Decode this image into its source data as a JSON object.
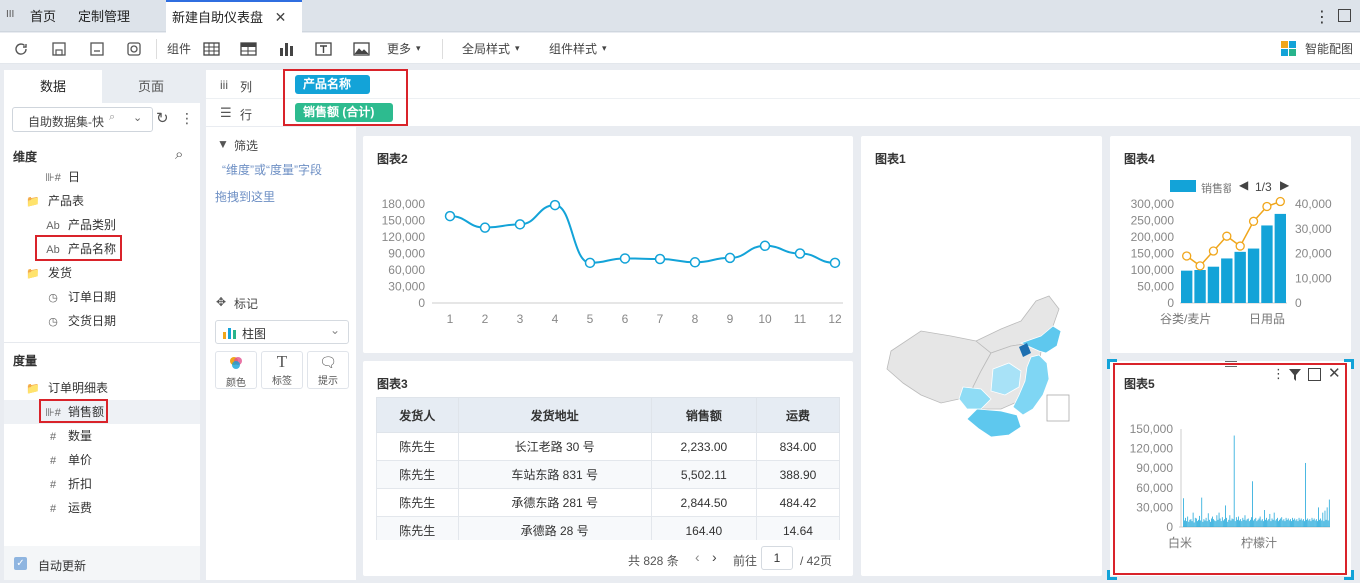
{
  "tabs": {
    "home": "首页",
    "custom": "定制管理",
    "active": "新建自助仪表盘"
  },
  "toolbar": {
    "component": "组件",
    "more": "更多",
    "global_style": "全局样式",
    "component_style": "组件样式",
    "smart": "智能配图"
  },
  "left": {
    "tab_data": "数据",
    "tab_page": "页面",
    "dataset": "自助数据集-快",
    "dim_header": "维度",
    "measure_header": "度量",
    "dims": [
      {
        "icon": "day",
        "text": "日"
      },
      {
        "icon": "folder",
        "text": "产品表"
      },
      {
        "icon": "text",
        "text": "产品类别"
      },
      {
        "icon": "text",
        "text": "产品名称"
      },
      {
        "icon": "folder",
        "text": "发货"
      },
      {
        "icon": "date",
        "text": "订单日期"
      },
      {
        "icon": "date",
        "text": "交货日期"
      }
    ],
    "measures": [
      {
        "icon": "folder",
        "text": "订单明细表"
      },
      {
        "icon": "measure",
        "text": "销售额"
      },
      {
        "icon": "hash",
        "text": "数量"
      },
      {
        "icon": "hash",
        "text": "单价"
      },
      {
        "icon": "hash",
        "text": "折扣"
      },
      {
        "icon": "hash",
        "text": "运费"
      }
    ],
    "auto_update": "自动更新"
  },
  "shelf": {
    "col_label": "列",
    "row_label": "行",
    "col_pill": "产品名称",
    "row_pill": "销售额 (合计)"
  },
  "filter": {
    "title": "筛选",
    "hint": "“维度”或“度量”字段",
    "hint2": "拖拽到这里"
  },
  "marks": {
    "title": "标记",
    "chart_type": "柱图",
    "color": "颜色",
    "label": "标签",
    "tooltip": "提示"
  },
  "colors": {
    "accent": "#13a3d8",
    "green": "#28b48c",
    "red": "#d9232a",
    "orange": "#f0a61b"
  },
  "chart2": {
    "title": "图表2"
  },
  "chart1": {
    "title": "图表1"
  },
  "chart4": {
    "title": "图表4",
    "legend": "销售额",
    "page": "1/3",
    "cat_a": "谷类/麦片",
    "cat_b": "日用品"
  },
  "chart5": {
    "title": "图表5",
    "cat_a": "白米",
    "cat_b": "柠檬汁"
  },
  "chart3": {
    "title": "图表3",
    "headers": [
      "发货人",
      "发货地址",
      "销售额",
      "运费"
    ],
    "rows": [
      [
        "陈先生",
        "长江老路 30 号",
        "2,233.00",
        "834.00"
      ],
      [
        "陈先生",
        "车站东路 831 号",
        "5,502.11",
        "388.90"
      ],
      [
        "陈先生",
        "承德东路 281 号",
        "2,844.50",
        "484.42"
      ],
      [
        "陈先生",
        "承德路 28 号",
        "164.40",
        "14.64"
      ]
    ],
    "pager_total": "共 828 条",
    "pager_goto": "前往",
    "pager_page": "1",
    "pager_pages": "/ 42页"
  },
  "chart_data": [
    {
      "type": "line",
      "title": "图表2",
      "x": [
        1,
        2,
        3,
        4,
        5,
        6,
        7,
        8,
        9,
        10,
        11,
        12
      ],
      "values": [
        158000,
        137000,
        143000,
        178000,
        73000,
        81000,
        80000,
        74000,
        82000,
        104000,
        90000,
        73000
      ],
      "ylim": [
        0,
        180000
      ],
      "yticks": [
        "180,000",
        "150,000",
        "120,000",
        "90,000",
        "60,000",
        "30,000",
        "0"
      ],
      "xticks": [
        "1",
        "2",
        "3",
        "4",
        "5",
        "6",
        "7",
        "8",
        "9",
        "10",
        "11",
        "12"
      ]
    },
    {
      "type": "bar",
      "title": "图表4",
      "series": [
        {
          "name": "销售额",
          "values": [
            98000,
            100000,
            110000,
            135000,
            155000,
            165000,
            235000,
            270000
          ]
        },
        {
          "values": [
            19000,
            15000,
            21000,
            27000,
            23000,
            33000,
            39000,
            41000
          ]
        }
      ],
      "ylim": [
        0,
        300000
      ],
      "y2lim": [
        0,
        40000
      ],
      "yticks": [
        "300,000",
        "250,000",
        "200,000",
        "150,000",
        "100,000",
        "50,000",
        "0"
      ],
      "y2ticks": [
        "40,000",
        "30,000",
        "20,000",
        "10,000",
        "0"
      ]
    },
    {
      "type": "bar",
      "title": "图表5",
      "ylim": [
        0,
        150000
      ],
      "yticks": [
        "150,000",
        "120,000",
        "90,000",
        "60,000",
        "30,000",
        "0"
      ],
      "values": [
        44000,
        10000,
        14000,
        9000,
        16000,
        8000,
        11000,
        12000,
        9000,
        22000,
        7000,
        14000,
        13000,
        9000,
        11000,
        17000,
        10000,
        45000,
        8000,
        12000,
        10000,
        14000,
        9000,
        21000,
        11000,
        8000,
        13000,
        16000,
        12000,
        10000,
        9000,
        18000,
        11000,
        22000,
        13000,
        9000,
        15000,
        10000,
        12000,
        33000,
        14000,
        8000,
        11000,
        18000,
        10000,
        13000,
        12000,
        140000,
        9000,
        15000,
        11000,
        16000,
        10000,
        12000,
        9000,
        14000,
        11000,
        18000,
        10000,
        12000,
        13000,
        9000,
        11000,
        15000,
        70000,
        10000,
        12000,
        14000,
        9000,
        11000,
        13000,
        16000,
        10000,
        12000,
        9000,
        26000,
        11000,
        14000,
        10000,
        12000,
        20000,
        9000,
        13000,
        11000,
        22000,
        10000,
        12000,
        14000,
        9000,
        11000,
        13000,
        15000,
        10000,
        12000,
        9000,
        14000,
        11000,
        13000,
        10000,
        12000,
        9000,
        14000,
        11000,
        13000,
        10000,
        12000,
        9000,
        14000,
        11000,
        13000,
        10000,
        12000,
        9000,
        98000,
        11000,
        13000,
        10000,
        12000,
        9000,
        14000,
        11000,
        13000,
        10000,
        12000,
        9000,
        30000,
        11000,
        13000,
        10000,
        22000,
        9000,
        25000,
        11000,
        30000,
        10000,
        42000
      ]
    }
  ]
}
